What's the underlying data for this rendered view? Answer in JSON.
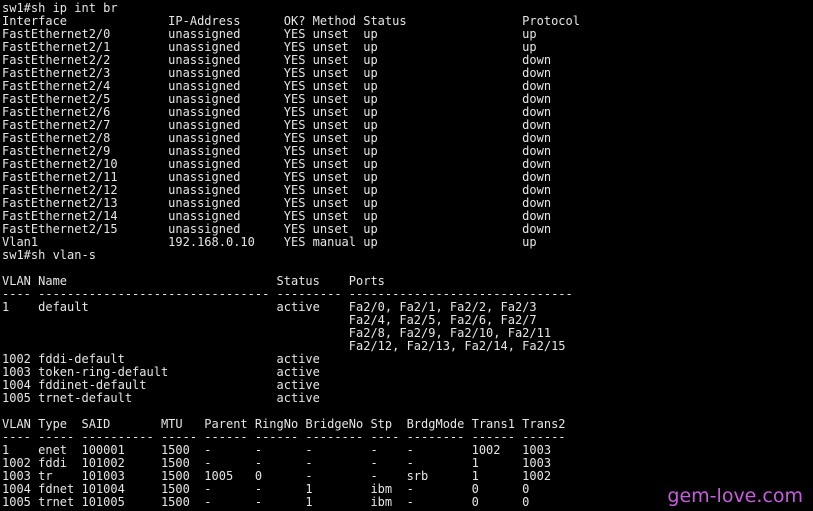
{
  "terminal": {
    "lines": [
      "sw1#sh ip int br",
      "Interface              IP-Address      OK? Method Status                Protocol",
      "FastEthernet2/0        unassigned      YES unset  up                    up",
      "FastEthernet2/1        unassigned      YES unset  up                    up",
      "FastEthernet2/2        unassigned      YES unset  up                    down",
      "FastEthernet2/3        unassigned      YES unset  up                    down",
      "FastEthernet2/4        unassigned      YES unset  up                    down",
      "FastEthernet2/5        unassigned      YES unset  up                    down",
      "FastEthernet2/6        unassigned      YES unset  up                    down",
      "FastEthernet2/7        unassigned      YES unset  up                    down",
      "FastEthernet2/8        unassigned      YES unset  up                    down",
      "FastEthernet2/9        unassigned      YES unset  up                    down",
      "FastEthernet2/10       unassigned      YES unset  up                    down",
      "FastEthernet2/11       unassigned      YES unset  up                    down",
      "FastEthernet2/12       unassigned      YES unset  up                    down",
      "FastEthernet2/13       unassigned      YES unset  up                    down",
      "FastEthernet2/14       unassigned      YES unset  up                    down",
      "FastEthernet2/15       unassigned      YES unset  up                    down",
      "Vlan1                  192.168.0.10    YES manual up                    up",
      "sw1#sh vlan-s",
      "",
      "VLAN Name                             Status    Ports",
      "---- -------------------------------- --------- -------------------------------",
      "1    default                          active    Fa2/0, Fa2/1, Fa2/2, Fa2/3",
      "                                                Fa2/4, Fa2/5, Fa2/6, Fa2/7",
      "                                                Fa2/8, Fa2/9, Fa2/10, Fa2/11",
      "                                                Fa2/12, Fa2/13, Fa2/14, Fa2/15",
      "1002 fddi-default                     active",
      "1003 token-ring-default               active",
      "1004 fddinet-default                  active",
      "1005 trnet-default                    active",
      "",
      "VLAN Type  SAID       MTU   Parent RingNo BridgeNo Stp  BrdgMode Trans1 Trans2",
      "---- ----- ---------- ----- ------ ------ -------- ---- -------- ------ ------",
      "1    enet  100001     1500  -      -      -        -    -        1002   1003",
      "1002 fddi  101002     1500  -      -      -        -    -        1      1003",
      "1003 tr    101003     1500  1005   0      -        -    srb      1      1002",
      "1004 fdnet 101004     1500  -      -      1        ibm  -        0      0",
      "1005 trnet 101005     1500  -      -      1        ibm  -        0      0"
    ],
    "watermark": "gem-love.com",
    "colors": {
      "background": "#000000",
      "text": "#e6e6e6",
      "watermark": "#c85ce0"
    }
  }
}
